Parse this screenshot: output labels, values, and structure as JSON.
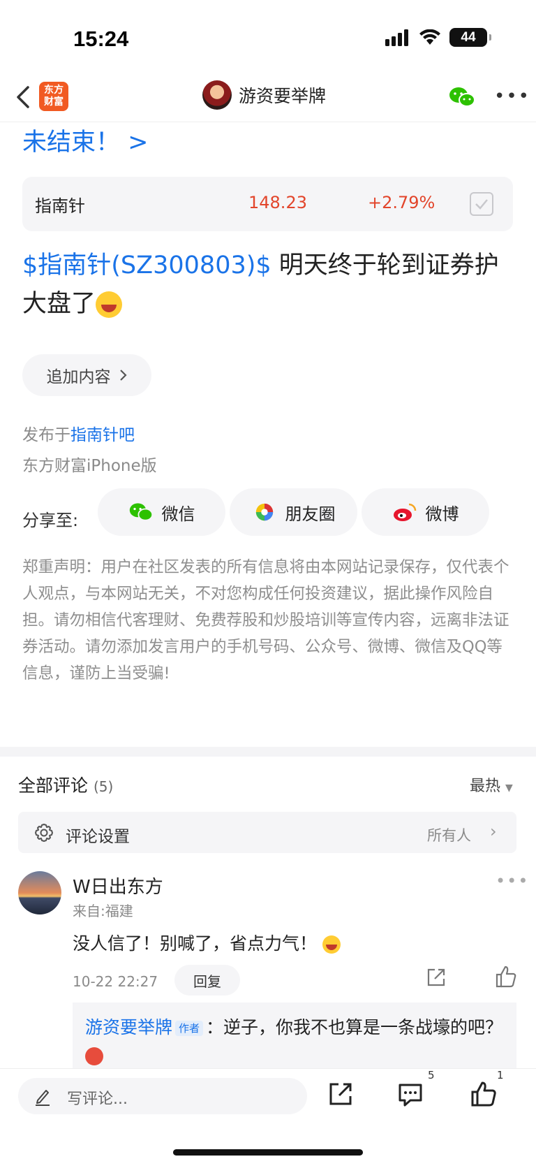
{
  "status_bar": {
    "time": "15:24",
    "battery": "44"
  },
  "nav": {
    "app_logo_line1": "东方",
    "app_logo_line2": "财富",
    "title": "游资要举牌"
  },
  "post": {
    "prev_link": "未结束！ >",
    "stock": {
      "name": "指南针",
      "price": "148.23",
      "change": "+2.79%"
    },
    "tag": "$指南针(SZ300803)$",
    "body": " 明天终于轮到证券护大盘了",
    "add_content_label": "追加内容",
    "published_prefix": "发布于",
    "forum": "指南针吧",
    "device": "东方财富iPhone版"
  },
  "share": {
    "label": "分享至:",
    "targets": [
      "微信",
      "朋友圈",
      "微博"
    ]
  },
  "disclaimer": "郑重声明：用户在社区发表的所有信息将由本网站记录保存，仅代表个人观点，与本网站无关，不对您构成任何投资建议，据此操作风险自担。请勿相信代客理财、免费荐股和炒股培训等宣传内容，远离非法证券活动。请勿添加发言用户的手机号码、公众号、微博、微信及QQ等信息，谨防上当受骗!",
  "comments": {
    "title": "全部评论",
    "count": "(5)",
    "sort": "最热",
    "settings_label": "评论设置",
    "settings_value": "所有人",
    "items": [
      {
        "name": "W日出东方",
        "location": "来自:福建",
        "text": "没人信了！别喊了，省点力气！",
        "time": "10-22 22:27",
        "reply_label": "回复",
        "sub_reply": {
          "author": "游资要举牌",
          "author_tag": "作者",
          "text": "：逆子，你我不也算是一条战壕的吧？"
        }
      }
    ]
  },
  "bottom_bar": {
    "input_placeholder": "写评论...",
    "comment_count": "5",
    "like_count": "1"
  },
  "colors": {
    "link_blue": "#1a73e8",
    "price_red": "#e2452b",
    "brand_orange": "#f15a22",
    "wechat_green": "#2dc100"
  }
}
